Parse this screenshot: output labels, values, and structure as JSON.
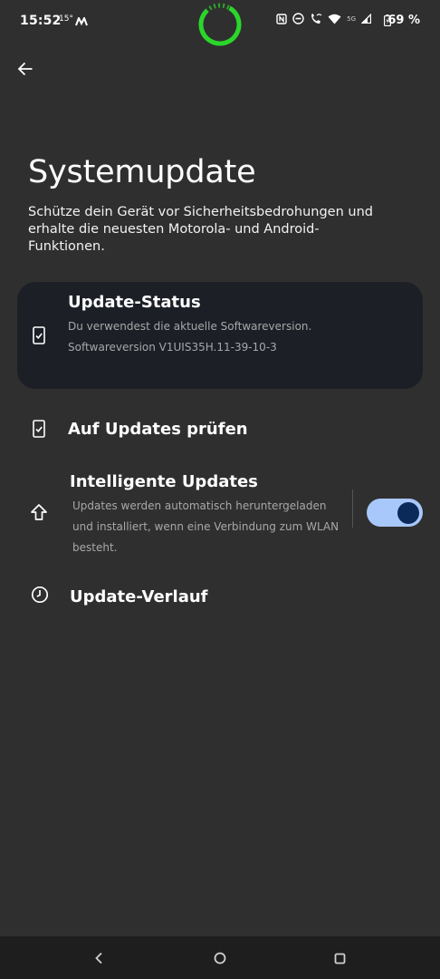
{
  "status_bar": {
    "time": "15:52",
    "temperature": "15°",
    "battery_percent": "69 %",
    "network": "5G",
    "icons": [
      "moto-icon",
      "progress-ring-icon",
      "nfc-icon",
      "dnd-icon",
      "wifi-call-icon",
      "wifi-icon",
      "signal-icon",
      "battery-icon"
    ]
  },
  "header": {
    "back_icon": "arrow-left-icon",
    "title": "Systemupdate",
    "subtitle": "Schütze dein Gerät vor Sicherheitsbedrohungen und erhalte die neuesten Motorola- und Android-Funktionen."
  },
  "status_card": {
    "icon": "phone-check-icon",
    "title": "Update-Status",
    "line1": "Du verwendest die aktuelle Softwareversion.",
    "line2": "Softwareversion V1UIS35H.11-39-10-3"
  },
  "items": {
    "check": {
      "icon": "phone-check-icon",
      "label": "Auf Updates prüfen"
    },
    "smart": {
      "icon": "arrow-up-icon",
      "label": "Intelligente Updates",
      "description": "Updates werden automatisch heruntergeladen und installiert, wenn eine Verbindung zum WLAN besteht.",
      "toggle_on": true
    },
    "history": {
      "icon": "clock-icon",
      "label": "Update-Verlauf"
    }
  },
  "colors": {
    "background": "#2f2f2f",
    "card": "#1c1f26",
    "toggle_track": "#a8c7fa",
    "toggle_knob": "#0b2a5a",
    "ring": "#2bd62b"
  },
  "nav": {
    "icons": [
      "back-nav-icon",
      "home-nav-icon",
      "recents-nav-icon"
    ]
  }
}
